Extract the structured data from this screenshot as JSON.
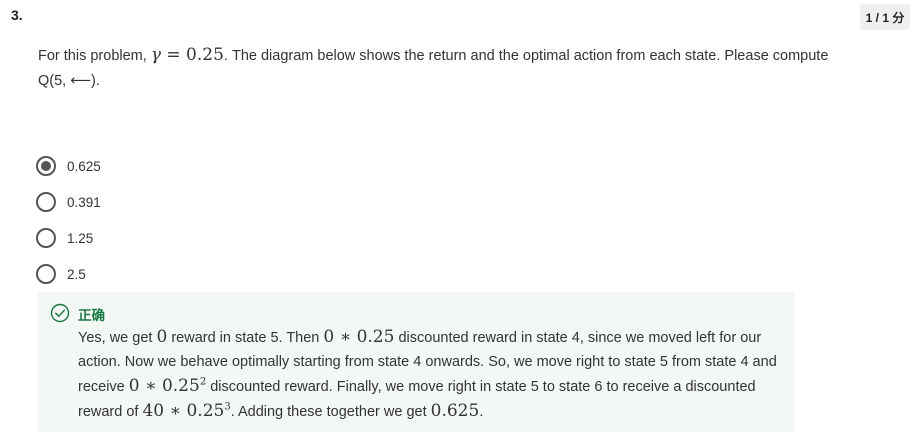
{
  "question": {
    "number": "3.",
    "score": "1 / 1 分",
    "prompt": {
      "before_gamma": "For this problem, ",
      "gamma_symbol": "γ",
      "gamma_eq": " = 0.25",
      "after_gamma": ". The diagram below shows the return and the optimal action from each state. Please compute Q(5, ⟵)."
    }
  },
  "options": [
    {
      "label": "0.625",
      "selected": true
    },
    {
      "label": "0.391",
      "selected": false
    },
    {
      "label": "1.25",
      "selected": false
    },
    {
      "label": "2.5",
      "selected": false
    }
  ],
  "feedback": {
    "title": "正确",
    "icon": "check-circle-icon",
    "color": "#1d7a45",
    "seg1": "Yes, we get ",
    "m1": "0",
    "seg2": " reward in state 5. Then ",
    "m2": "0 ∗ 0.25",
    "seg3": " discounted reward in state 4, since we moved left for our action. Now we behave optimally starting from state 4 onwards. So, we move right to state 5 from state 4 and receive ",
    "m3": "0 ∗ 0.25",
    "m3_exp": "2",
    "seg4": " discounted reward. Finally, we move right in state 5 to state 6 to receive a discounted reward of ",
    "m4": "40 ∗ 0.25",
    "m4_exp": "3",
    "seg5": ". Adding these together we get ",
    "m5": "0.625",
    "seg6": "."
  }
}
